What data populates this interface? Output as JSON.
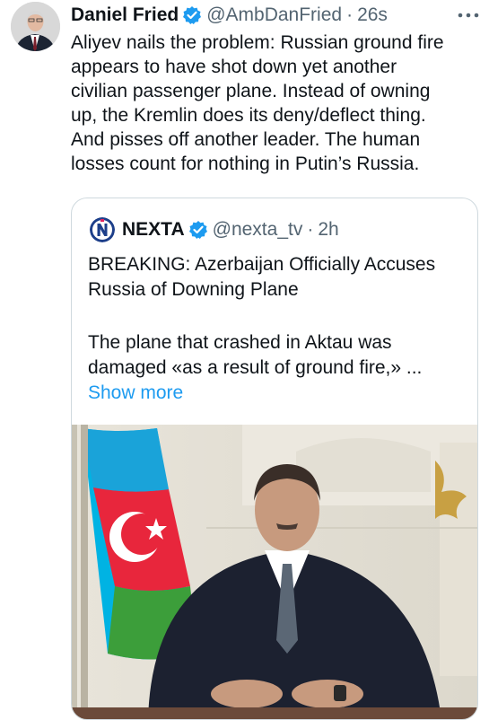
{
  "tweet": {
    "author_name": "Daniel Fried",
    "handle": "@AmbDanFried",
    "separator": "·",
    "time": "26s",
    "more_icon": "more-dots-icon",
    "verified_icon": "verified-badge-icon",
    "text": "Aliyev nails the problem: Russian ground fire\nappears to have shot down yet another\ncivilian passenger plane. Instead of owning\nup, the Kremlin does its deny/deflect thing.\nAnd pisses off another leader. The human\nlosses count for nothing in Putin’s Russia."
  },
  "quoted": {
    "author_name": "NEXTA",
    "handle": "@nexta_tv",
    "separator": "·",
    "time": "2h",
    "title": "BREAKING: Azerbaijan Officially Accuses\nRussia of Downing Plane",
    "body": "The plane that crashed in Aktau was\ndamaged «as a result of ground fire,» ...",
    "show_more": "Show more"
  },
  "colors": {
    "accent": "#1d9bf0",
    "muted": "#536471",
    "border": "#cfd9de"
  }
}
